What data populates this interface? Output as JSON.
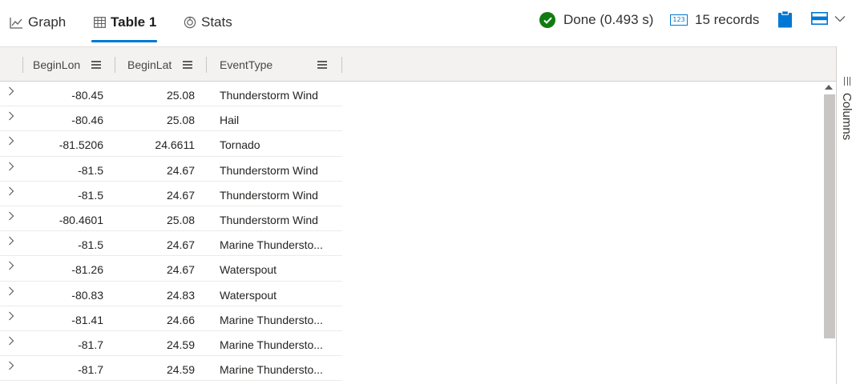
{
  "tabs": [
    {
      "label": "Graph",
      "icon": "line-chart-icon"
    },
    {
      "label": "Table 1",
      "icon": "table-icon",
      "selected": true
    },
    {
      "label": "Stats",
      "icon": "stats-icon"
    }
  ],
  "status": {
    "text": "Done (0.493 s)",
    "icon": "check-circle-icon",
    "color": "#107c10"
  },
  "records": {
    "text": "15 records",
    "icon_text": "123",
    "icon": "number-icon"
  },
  "toolbar_icons": {
    "copy": "clipboard-icon",
    "view": "view-layout-icon",
    "dropdown": "chevron-down-icon"
  },
  "accent_color": "#0078d4",
  "columns": [
    "BeginLon",
    "BeginLat",
    "EventType"
  ],
  "rows": [
    [
      "-80.45",
      "25.08",
      "Thunderstorm Wind"
    ],
    [
      "-80.46",
      "25.08",
      "Hail"
    ],
    [
      "-81.5206",
      "24.6611",
      "Tornado"
    ],
    [
      "-81.5",
      "24.67",
      "Thunderstorm Wind"
    ],
    [
      "-81.5",
      "24.67",
      "Thunderstorm Wind"
    ],
    [
      "-80.4601",
      "25.08",
      "Thunderstorm Wind"
    ],
    [
      "-81.5",
      "24.67",
      "Marine Thundersto..."
    ],
    [
      "-81.26",
      "24.67",
      "Waterspout"
    ],
    [
      "-80.83",
      "24.83",
      "Waterspout"
    ],
    [
      "-81.41",
      "24.66",
      "Marine Thundersto..."
    ],
    [
      "-81.7",
      "24.59",
      "Marine Thundersto..."
    ],
    [
      "-81.7",
      "24.59",
      "Marine Thundersto..."
    ]
  ],
  "side_panel": {
    "label": "Columns",
    "icon": "columns-icon"
  }
}
